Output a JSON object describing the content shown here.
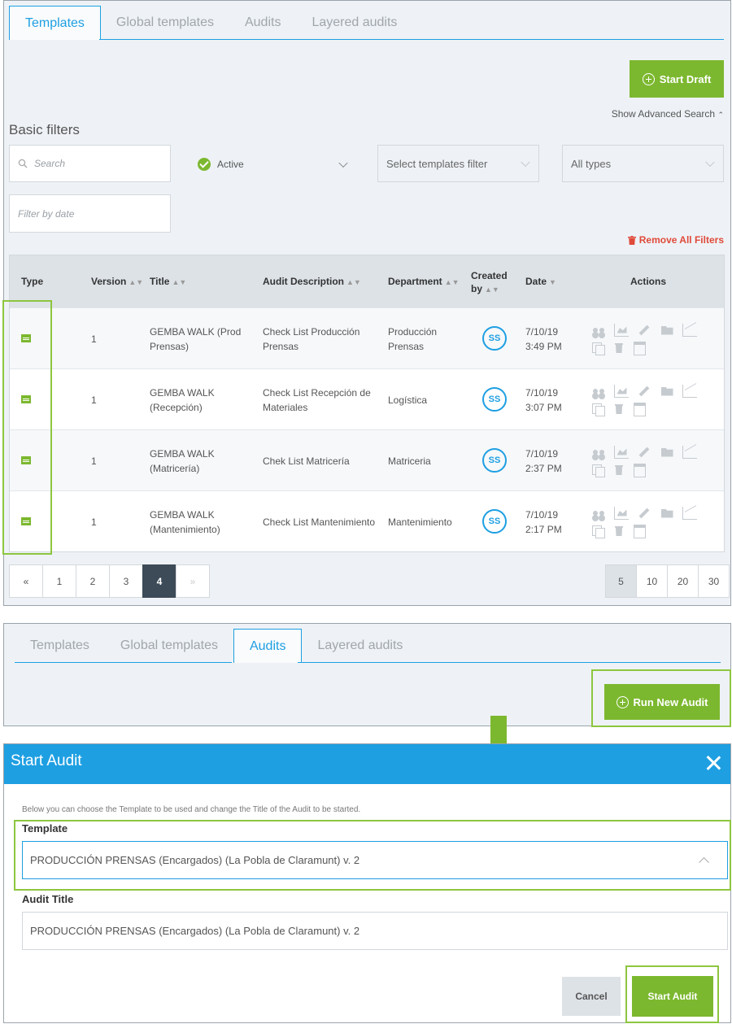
{
  "templates_view": {
    "tabs": [
      {
        "label": "Templates"
      },
      {
        "label": "Global templates"
      },
      {
        "label": "Audits"
      },
      {
        "label": "Layered audits"
      }
    ],
    "active_tab": "Templates",
    "start_draft_label": "Start Draft",
    "advanced_search_label": "Show Advanced Search",
    "basic_filters_title": "Basic filters",
    "search_placeholder": "Search",
    "status_filter": "Active",
    "templates_filter_placeholder": "Select templates filter",
    "type_filter": "All types",
    "date_filter_placeholder": "Filter by date",
    "remove_filters_label": "Remove All Filters",
    "table": {
      "columns": {
        "type": "Type",
        "version": "Version",
        "title": "Title",
        "description": "Audit Description",
        "department": "Department",
        "created_by_1": "Created",
        "created_by_2": "by",
        "date": "Date",
        "actions": "Actions"
      },
      "rows": [
        {
          "version": "1",
          "title_1": "GEMBA WALK (Prod",
          "title_2": "Prensas)",
          "desc_1": "Check List Producción",
          "desc_2": "Prensas",
          "dept_1": "Producción",
          "dept_2": "Prensas",
          "creator": "SS",
          "date_1": "7/10/19",
          "date_2": "3:49 PM"
        },
        {
          "version": "1",
          "title_1": "GEMBA WALK",
          "title_2": "(Recepción)",
          "desc_1": "Check List Recepción de",
          "desc_2": "Materiales",
          "dept_1": "Logística",
          "dept_2": "",
          "creator": "SS",
          "date_1": "7/10/19",
          "date_2": "3:07 PM"
        },
        {
          "version": "1",
          "title_1": "GEMBA WALK",
          "title_2": "(Matricería)",
          "desc_1": "Chek List Matricería",
          "desc_2": "",
          "dept_1": "Matriceria",
          "dept_2": "",
          "creator": "SS",
          "date_1": "7/10/19",
          "date_2": "2:37 PM"
        },
        {
          "version": "1",
          "title_1": "GEMBA WALK",
          "title_2": "(Mantenimiento)",
          "desc_1": "Check List Mantenimiento",
          "desc_2": "",
          "dept_1": "Mantenimiento",
          "dept_2": "",
          "creator": "SS",
          "date_1": "7/10/19",
          "date_2": "2:17 PM"
        }
      ]
    },
    "pagination": {
      "prev": "«",
      "pages": [
        "1",
        "2",
        "3",
        "4"
      ],
      "current": "4",
      "next": "»",
      "page_sizes": [
        "5",
        "10",
        "20",
        "30"
      ],
      "current_size": "5"
    }
  },
  "audits_view": {
    "tabs": [
      {
        "label": "Templates"
      },
      {
        "label": "Global templates"
      },
      {
        "label": "Audits"
      },
      {
        "label": "Layered audits"
      }
    ],
    "active_tab": "Audits",
    "run_new_audit_label": "Run New Audit"
  },
  "start_audit_modal": {
    "title": "Start Audit",
    "description": "Below you can choose the Template to be used and change the Title of the Audit to be started.",
    "template_label": "Template",
    "template_value": "PRODUCCIÓN PRENSAS (Encargados) (La Pobla de Claramunt) v. 2",
    "audit_title_label": "Audit Title",
    "audit_title_value": "PRODUCCIÓN PRENSAS (Encargados) (La Pobla de Claramunt) v. 2",
    "cancel_label": "Cancel",
    "start_label": "Start Audit"
  },
  "colors": {
    "accent_blue": "#1e9fe2",
    "action_green": "#7cb82f",
    "highlight_green": "#8dc63f",
    "danger_red": "#e04a3a",
    "pager_active": "#3d4b58"
  }
}
